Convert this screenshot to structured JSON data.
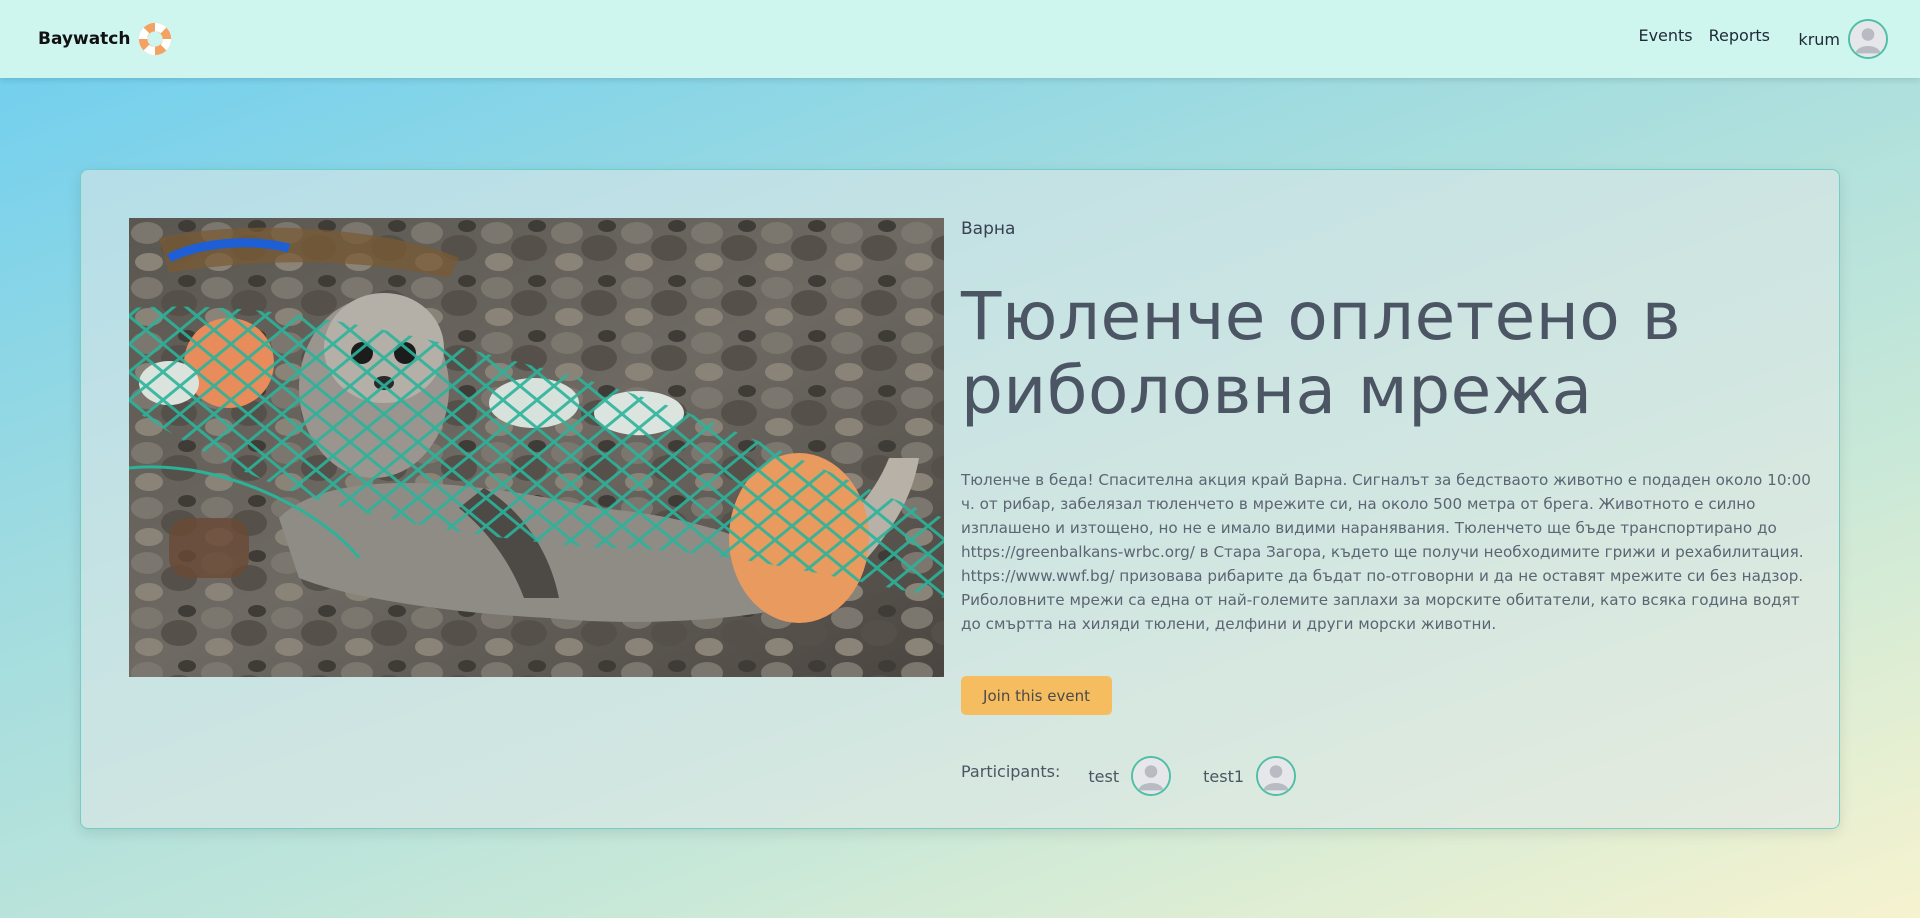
{
  "navbar": {
    "brand": "Baywatch",
    "links": [
      "Events",
      "Reports"
    ],
    "user": "krum"
  },
  "event": {
    "location": "Варна",
    "title": "Тюленче оплетено в риболовна мрежа",
    "description": "Тюленче в беда! Спасителна акция край Варна. Сигналът за бедстваото животно е подаден около 10:00 ч. от рибар, забелязал тюленчето в мрежите си, на около 500 метра от брега. Животното е силно изплашено и изтощено, но не е имало видими наранявания. Тюленчето ще бъде транспортирано до https://greenbalkans-wrbc.org/ в Стара Загора, където ще получи необходимите грижи и рехабилитация. https://www.wwf.bg/ призовава рибарите да бъдат по-отговорни и да не оставят мрежите си без надзор. Риболовните мрежи са една от най-големите заплахи за морските обитатели, като всяка година водят до смъртта на хиляди тюлени, делфини и други морски животни.",
    "join_label": "Join this event",
    "participants_label": "Participants:",
    "participants": [
      "test",
      "test1"
    ]
  },
  "colors": {
    "navbar_bg": "#cef5ee",
    "accent_button": "#f6bd60",
    "avatar_border": "#4fbfa6",
    "card_border": "#6fcfc4"
  },
  "icons": {
    "logo": "lifebuoy-logo-icon",
    "avatar": "user-avatar-icon"
  }
}
